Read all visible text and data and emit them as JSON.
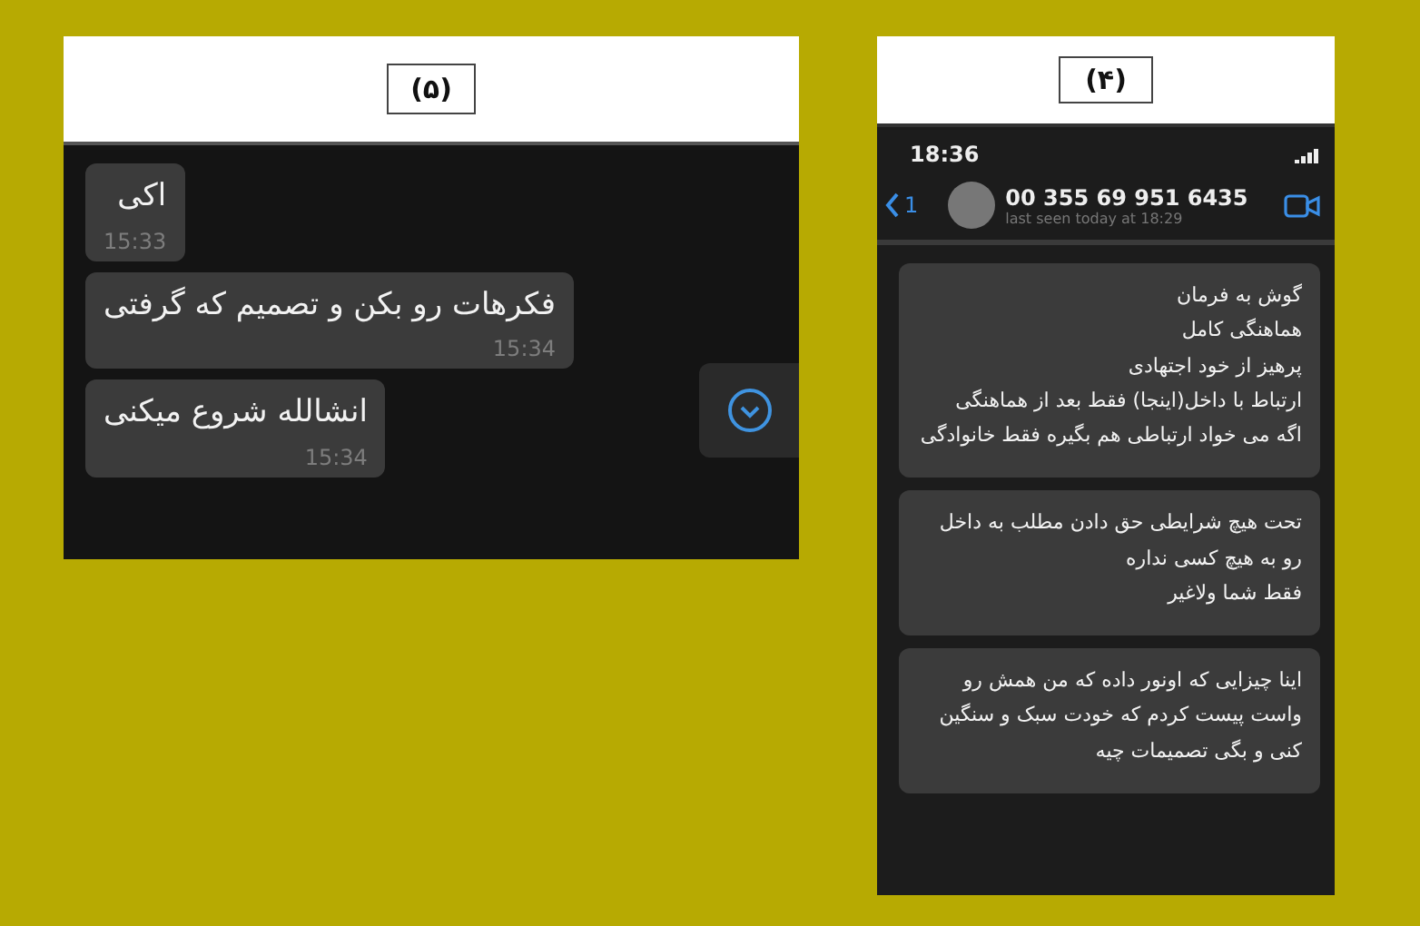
{
  "left_screenshot": {
    "label": "(۵)",
    "messages": [
      {
        "text": "اکی",
        "time": "15:33"
      },
      {
        "text": "فکرهات رو بکن و تصمیم که گرفتی",
        "time": "15:34"
      },
      {
        "text": "انشالله شروع میکنی",
        "time": "15:34"
      }
    ]
  },
  "right_screenshot": {
    "label": "(۴)",
    "status_time": "18:36",
    "header": {
      "back_count": "1",
      "contact": "00 355 69 951 6435",
      "last_seen": "last seen today at 18:29"
    },
    "messages": [
      {
        "text": "گوش به فرمان\nهماهنگی کامل\nپرهیز از خود اجتهادی\nارتباط با داخل(اینجا) فقط بعد از هماهنگی\nاگه می خواد ارتباطی هم بگیره فقط خانوادگی"
      },
      {
        "text": "تحت هیچ شرایطی حق دادن مطلب به داخل رو به هیچ کسی نداره\nفقط شما ولاغیر"
      },
      {
        "text": "اینا چیزایی که اونور داده که من همش رو واست پیست کردم که خودت سبک و سنگین کنی و بگی تصمیمات چیه"
      }
    ]
  }
}
